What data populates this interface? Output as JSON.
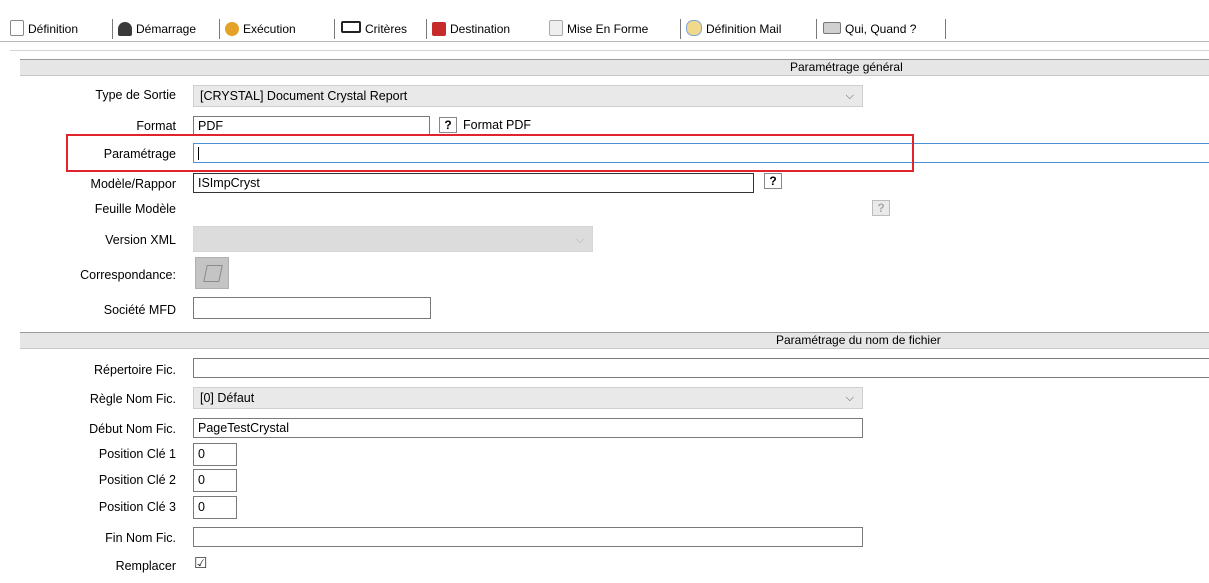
{
  "tabs": [
    {
      "label": "Définition",
      "icon": "document-icon"
    },
    {
      "label": "Démarrage",
      "icon": "user-start-icon"
    },
    {
      "label": "Exécution",
      "icon": "gear-icon"
    },
    {
      "label": "Critères",
      "icon": "criteria-icon"
    },
    {
      "label": "Destination",
      "icon": "books-icon"
    },
    {
      "label": "Mise En Forme",
      "icon": "page-format-icon"
    },
    {
      "label": "Définition Mail",
      "icon": "mail-icon"
    },
    {
      "label": "Qui, Quand ?",
      "icon": "calendar-icon"
    }
  ],
  "active_tab": "Mise En Forme",
  "sections": {
    "general": "Paramétrage général",
    "filename": "Paramétrage du nom de fichier"
  },
  "form": {
    "type_sortie": {
      "label": "Type de Sortie",
      "value": "[CRYSTAL] Document Crystal Report"
    },
    "format": {
      "label": "Format",
      "value": "PDF",
      "help": "?",
      "help_text": "Format PDF"
    },
    "parametrage": {
      "label": "Paramétrage",
      "value": ""
    },
    "modele": {
      "label": "Modèle/Rappor",
      "value": "ISImpCryst",
      "help": "?"
    },
    "feuille": {
      "label": "Feuille Modèle",
      "help": "?"
    },
    "version_xml": {
      "label": "Version XML",
      "value": ""
    },
    "correspondance": {
      "label": "Correspondance:"
    },
    "societe": {
      "label": "Société MFD",
      "value": ""
    },
    "repertoire": {
      "label": "Répertoire Fic.",
      "value": ""
    },
    "regle": {
      "label": "Règle Nom Fic.",
      "value": "[0] Défaut"
    },
    "debut": {
      "label": "Début Nom Fic.",
      "value": "PageTestCrystal"
    },
    "cle1": {
      "label": "Position Clé 1",
      "value": "0"
    },
    "cle2": {
      "label": "Position Clé 2",
      "value": "0"
    },
    "cle3": {
      "label": "Position Clé 3",
      "value": "0"
    },
    "fin": {
      "label": "Fin Nom Fic.",
      "value": ""
    },
    "remplacer": {
      "label": "Remplacer",
      "checked": true,
      "mark": "☑"
    }
  },
  "colors": {
    "highlight": "#e0242a",
    "section_bg": "#e6e6e6"
  }
}
